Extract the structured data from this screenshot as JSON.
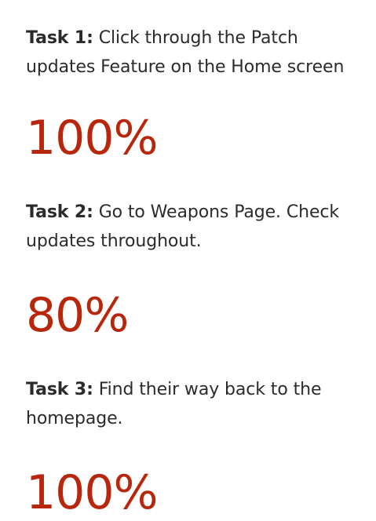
{
  "tasks": [
    {
      "label": "Task 1:",
      "description": " Click through the Patch updates Feature on the Home screen",
      "result": "100%"
    },
    {
      "label": "Task 2:",
      "description": " Go to Weapons Page. Check updates throughout.",
      "result": "80%"
    },
    {
      "label": "Task 3:",
      "description": " Find their way back to the homepage.",
      "result": "100%"
    }
  ],
  "colors": {
    "accent": "#b8260c",
    "text": "#2b2b2b",
    "background": "#ffffff"
  }
}
